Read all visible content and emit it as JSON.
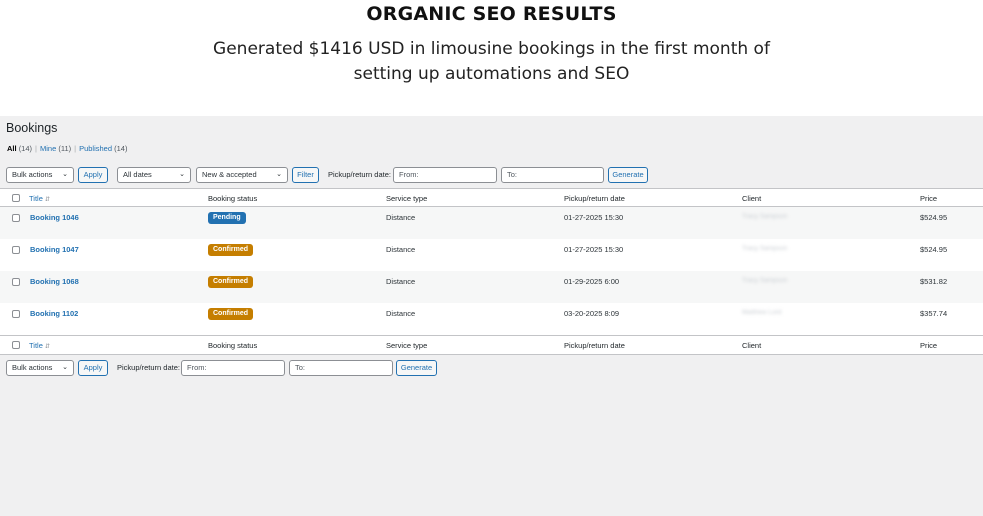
{
  "hero": {
    "heading": "ORGANIC SEO RESULTS",
    "subheading": "Generated $1416 USD in limousine bookings in the first month of setting up automations and SEO"
  },
  "page": {
    "title": "Bookings"
  },
  "views": {
    "all_label": "All",
    "all_count": "(14)",
    "mine_label": "Mine",
    "mine_count": "(11)",
    "published_label": "Published",
    "published_count": "(14)",
    "separator": "|"
  },
  "top_toolbar": {
    "bulk_actions": "Bulk actions",
    "apply": "Apply",
    "dates": "All dates",
    "status_filter": "New & accepted",
    "filter": "Filter",
    "date_label": "Pickup/return date:",
    "from_placeholder": "From:",
    "to_placeholder": "To:",
    "generate": "Generate"
  },
  "bottom_toolbar": {
    "bulk_actions": "Bulk actions",
    "apply": "Apply",
    "date_label": "Pickup/return date:",
    "from_placeholder": "From:",
    "to_placeholder": "To:",
    "generate": "Generate"
  },
  "columns": {
    "title": "Title",
    "status": "Booking status",
    "service": "Service type",
    "date": "Pickup/return date",
    "client": "Client",
    "price": "Price"
  },
  "rows": [
    {
      "title": "Booking 1046",
      "status": "Pending",
      "status_color": "#2271b1",
      "service": "Distance",
      "date": "01-27-2025 15:30",
      "client": "Tracy Sampson",
      "price": "$524.95"
    },
    {
      "title": "Booking 1047",
      "status": "Confirmed",
      "status_color": "#c57e00",
      "service": "Distance",
      "date": "01-27-2025 15:30",
      "client": "Tracy Sampson",
      "price": "$524.95"
    },
    {
      "title": "Booking 1068",
      "status": "Confirmed",
      "status_color": "#c57e00",
      "service": "Distance",
      "date": "01-29-2025 6:00",
      "client": "Tracy Sampson",
      "price": "$531.82"
    },
    {
      "title": "Booking 1102",
      "status": "Confirmed",
      "status_color": "#c57e00",
      "service": "Distance",
      "date": "03-20-2025 8:09",
      "client": "Matthew Lord",
      "price": "$357.74"
    }
  ]
}
